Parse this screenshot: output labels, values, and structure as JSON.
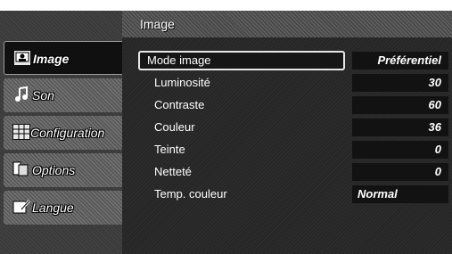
{
  "top_clip_text": "",
  "panel": {
    "title": "Image"
  },
  "sidebar": {
    "items": [
      {
        "label": "Image",
        "icon": "picture-icon",
        "active": true
      },
      {
        "label": "Son",
        "icon": "music-note-icon",
        "active": false
      },
      {
        "label": "Configuration",
        "icon": "grid-icon",
        "active": false
      },
      {
        "label": "Options",
        "icon": "options-icon",
        "active": false
      },
      {
        "label": "Langue",
        "icon": "pencil-note-icon",
        "active": false
      }
    ]
  },
  "settings": [
    {
      "label": "Mode image",
      "value": "Préférentiel"
    },
    {
      "label": "Luminosité",
      "value": "30"
    },
    {
      "label": "Contraste",
      "value": "60"
    },
    {
      "label": "Couleur",
      "value": "36"
    },
    {
      "label": "Teinte",
      "value": "0"
    },
    {
      "label": "Netteté",
      "value": "0"
    },
    {
      "label": "Temp. couleur",
      "value": "Normal"
    }
  ],
  "colors": {
    "panel_bg": "#262626",
    "sidebar_bg": "#3a3a3a",
    "highlight_border": "#e6e6e6",
    "text": "#ffffff"
  }
}
